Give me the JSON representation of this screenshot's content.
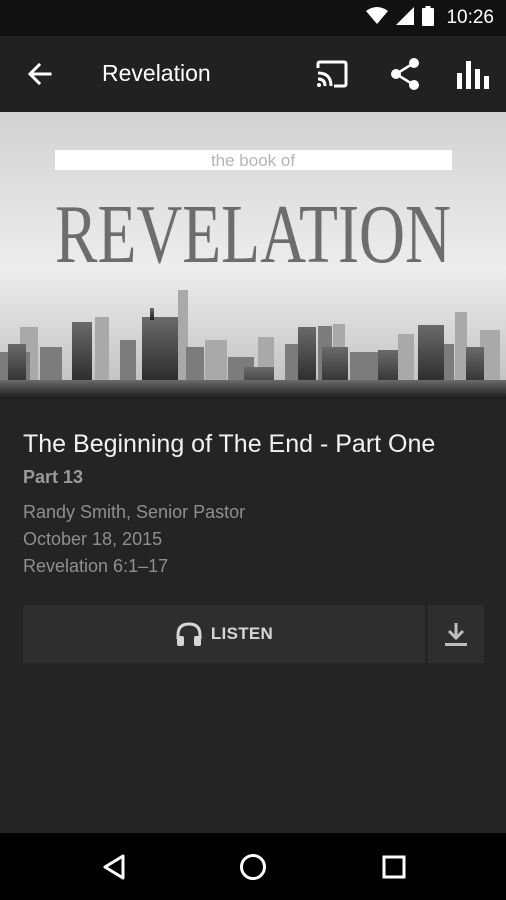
{
  "status_bar": {
    "time": "10:26",
    "icons": [
      "wifi-icon",
      "signal-icon",
      "battery-icon"
    ]
  },
  "app_bar": {
    "title": "Revelation",
    "actions": [
      "cast-icon",
      "share-icon",
      "equalizer-icon"
    ]
  },
  "hero": {
    "small_text": "the book of",
    "big_text": "REVELATION"
  },
  "sermon": {
    "title": "The Beginning of The End - Part One",
    "part": "Part 13",
    "speaker": "Randy Smith, Senior Pastor",
    "date": "October 18, 2015",
    "passage": "Revelation 6:1–17"
  },
  "actions": {
    "listen_label": "LISTEN"
  },
  "colors": {
    "background": "#242424",
    "app_bar": "#212121",
    "button": "#2e2e2e",
    "secondary_text": "#8f8f8f"
  }
}
